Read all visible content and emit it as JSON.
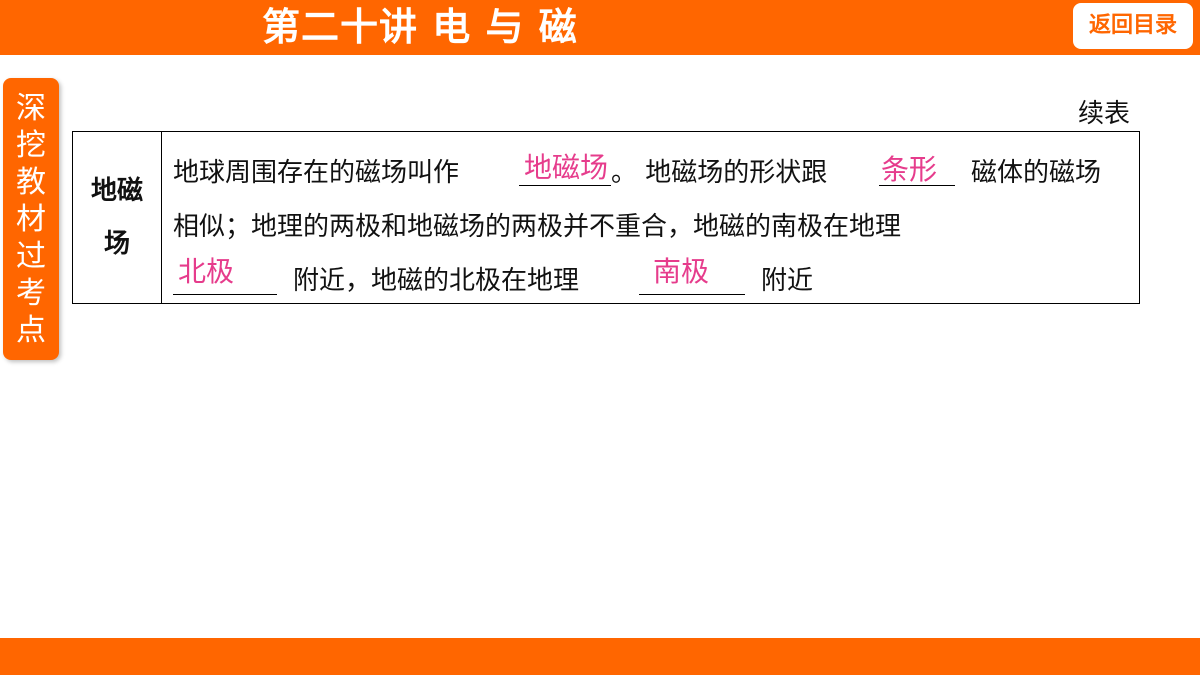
{
  "header": {
    "title": "第二十讲 电 与 磁",
    "back_button": "返回目录"
  },
  "side_tab": {
    "chars": [
      "深",
      "挖",
      "教",
      "材",
      "过",
      "考",
      "点"
    ]
  },
  "continued_label": "续表",
  "table": {
    "row_heading": [
      "地磁",
      "场"
    ],
    "line1_a": "地球周围存在的磁场叫作",
    "line1_b": "。 地磁场的形状跟",
    "line1_c": "磁体的磁场",
    "line2": "相似；地理的两极和地磁场的两极并不重合，地磁的南极在地理",
    "line3_a": "附近，地磁的北极在地理",
    "line3_b": "附近",
    "answers": [
      "地磁场",
      "条形",
      "北极",
      "南极"
    ]
  },
  "colors": {
    "accent": "#ff6600",
    "answer": "#e63c8c"
  }
}
